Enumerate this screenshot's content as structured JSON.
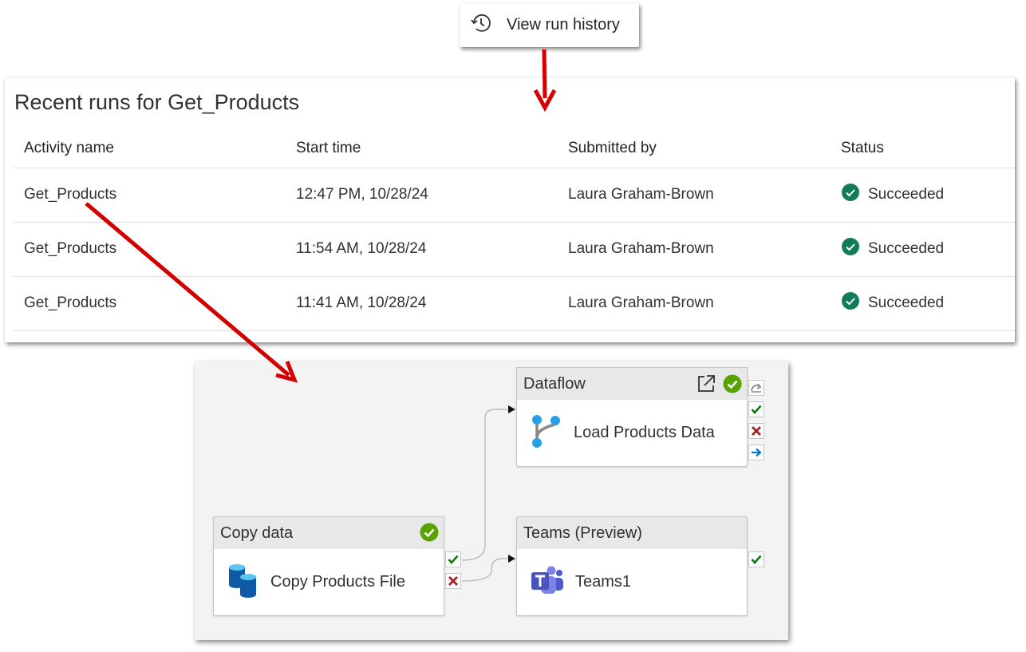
{
  "toolbar": {
    "view_run_history_label": "View run history",
    "icon": "history-icon"
  },
  "recent_runs": {
    "title": "Recent runs for Get_Products",
    "columns": [
      "Activity name",
      "Start time",
      "Submitted by",
      "Status"
    ],
    "rows": [
      {
        "activity": "Get_Products",
        "start": "12:47 PM, 10/28/24",
        "submitted_by": "Laura Graham-Brown",
        "status": "Succeeded"
      },
      {
        "activity": "Get_Products",
        "start": "11:54 AM, 10/28/24",
        "submitted_by": "Laura Graham-Brown",
        "status": "Succeeded"
      },
      {
        "activity": "Get_Products",
        "start": "11:41 AM, 10/28/24",
        "submitted_by": "Laura Graham-Brown",
        "status": "Succeeded"
      }
    ],
    "status_icon": "check-circle-icon"
  },
  "pipeline": {
    "copy": {
      "type": "Copy data",
      "name": "Copy Products File",
      "icon": "database-icon"
    },
    "dataflow": {
      "type": "Dataflow",
      "name": "Load Products Data",
      "icon": "dataflow-icon"
    },
    "teams": {
      "type": "Teams (Preview)",
      "name": "Teams1",
      "icon": "teams-icon"
    }
  },
  "colors": {
    "annotation_arrow": "#d40000",
    "success_green": "#57a300",
    "status_teal": "#107c5a",
    "fail_red": "#a4262c",
    "completion_blue": "#0078d4",
    "canvas_bg": "#f3f3f3"
  }
}
